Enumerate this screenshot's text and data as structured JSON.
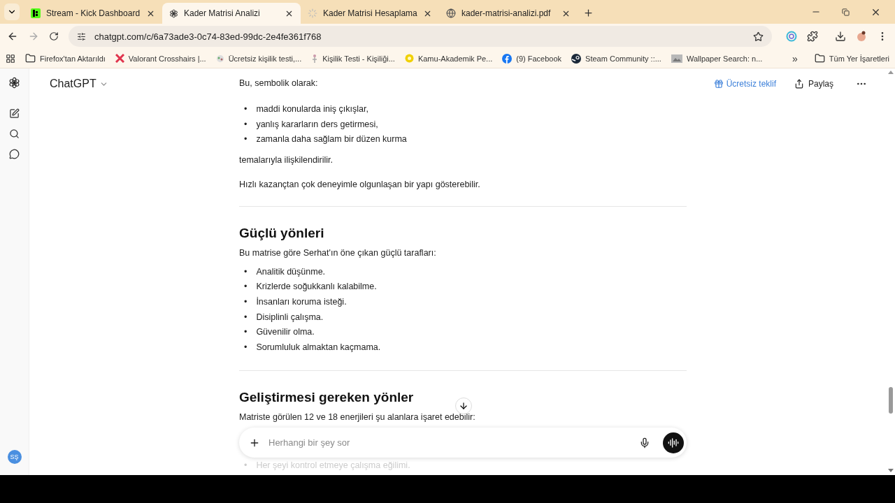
{
  "tabs": [
    {
      "title": "Stream - Kick Dashboard",
      "kind": "kick",
      "selected": false
    },
    {
      "title": "Kader Matrisi Analizi",
      "kind": "chatgpt",
      "selected": true
    },
    {
      "title": "Kader Matrisi Hesaplama",
      "kind": "loading",
      "selected": false
    },
    {
      "title": "kader-matrisi-analizi.pdf",
      "kind": "globe",
      "selected": false
    }
  ],
  "address": {
    "url": "chatgpt.com/c/6a73ade3-0c74-83ed-99dc-2e4fe361f768"
  },
  "bookmarks": [
    {
      "label": "Firefox'tan Aktarıldı",
      "kind": "folder"
    },
    {
      "label": "Valorant Crosshairs |...",
      "kind": "cross"
    },
    {
      "label": "Ücretsiz kişilik testi,...",
      "kind": "dots"
    },
    {
      "label": "Kişilik Testi - Kişiliği...",
      "kind": "figure"
    },
    {
      "label": "Kamu-Akademik Pe...",
      "kind": "yellow"
    },
    {
      "label": "(9) Facebook",
      "kind": "facebook"
    },
    {
      "label": "Steam Community ::...",
      "kind": "steam"
    },
    {
      "label": "Wallpaper Search: n...",
      "kind": "image"
    }
  ],
  "bookmarks_overflow": "»",
  "all_bookmarks": "Tüm Yer İşaretleri",
  "sidebar": {
    "avatar": "SŞ"
  },
  "header": {
    "model": "ChatGPT",
    "offer": "Ücretsiz teklif",
    "share": "Paylaş"
  },
  "content": [
    {
      "kind": "paragraph",
      "text": "Bu, sembolik olarak:"
    },
    {
      "kind": "bullets",
      "items": [
        "maddi konularda iniş çıkışlar,",
        "yanlış kararların ders getirmesi,",
        "zamanla daha sağlam bir düzen kurma"
      ]
    },
    {
      "kind": "paragraph",
      "text": "temalarıyla ilişkilendirilir."
    },
    {
      "kind": "paragraph",
      "text": "Hızlı kazançtan çok deneyimle olgunlaşan bir yapı gösterebilir."
    },
    {
      "kind": "divider"
    },
    {
      "kind": "heading",
      "text": "Güçlü yönleri"
    },
    {
      "kind": "lead",
      "text": "Bu matrise göre Serhat'ın öne çıkan güçlü tarafları:"
    },
    {
      "kind": "bullets",
      "items": [
        "Analitik düşünme.",
        "Krizlerde soğukkanlı kalabilme.",
        "İnsanları koruma isteği.",
        "Disiplinli çalışma.",
        "Güvenilir olma.",
        "Sorumluluk almaktan kaçmama."
      ]
    },
    {
      "kind": "divider"
    },
    {
      "kind": "heading",
      "text": "Geliştirmesi gereken yönler"
    },
    {
      "kind": "lead",
      "text": "Matriste görülen 12 ve 18 enerjileri şu alanlara işaret edebilir:"
    }
  ],
  "bullet_marker": "•",
  "composer": {
    "placeholder": "Herhangi bir şey sor"
  },
  "faded_bullet": "Her şeyi kontrol etmeye çalışma eğilimi."
}
